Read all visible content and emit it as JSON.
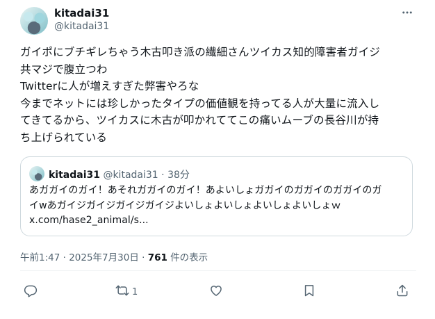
{
  "author": {
    "display_name": "kitadai31",
    "handle": "@kitadai31"
  },
  "tweet": {
    "text": "ガイポにブチギレちゃう木古叩き派の繊細さんツイカス知的障害者ガイジ\n共マジで腹立つわ\nTwitterに人が増えすぎた弊害やろな\n今までネットには珍しかったタイプの価値観を持ってる人が大量に流入し\nてきてるから、ツイカスに木古が叩かれててこの痛いムーブの長谷川が持\nち上げられている"
  },
  "quote": {
    "display_name": "kitadai31",
    "handle": "@kitadai31",
    "separator": " · ",
    "time": "38分",
    "text": "あガガイのガイ！あそれガガイのガイ！あよいしょガガイのガガイのガガイのガ\nイwあガイジガイジガイジガイジよいしょよいしょよいしょよいしょｗ\nx.com/hase2_animal/s..."
  },
  "meta": {
    "time": "午前1:47",
    "separator": " · ",
    "date": "2025年7月30日",
    "views_count": "761",
    "views_label": " 件の表示"
  },
  "actions": {
    "reply_icon": "reply-icon",
    "retweet_icon": "retweet-icon",
    "retweet_count": "1",
    "like_icon": "heart-icon",
    "bookmark_icon": "bookmark-icon",
    "share_icon": "share-icon"
  }
}
